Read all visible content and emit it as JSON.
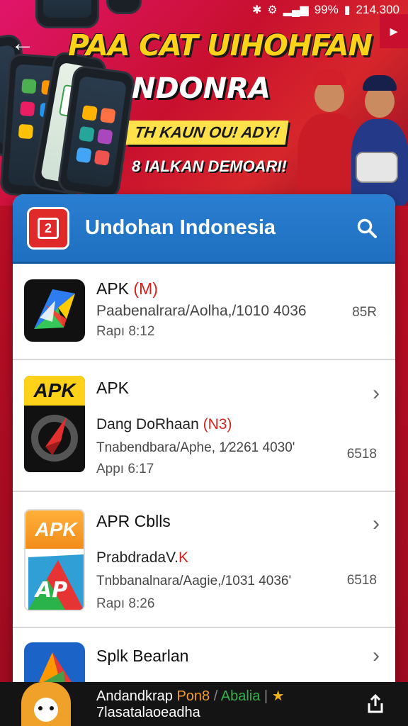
{
  "status_bar": {
    "battery": "99%",
    "time": "214.300"
  },
  "banner": {
    "headline": "PAA CAT UIHOHFAN",
    "subhead": "NDONRA",
    "tagline1": "TH KAUN OU! ADY!",
    "tagline2": "8 IALKAN DEMOARI!"
  },
  "header": {
    "logo_text": "2",
    "title": "Undohan Indonesia"
  },
  "items": [
    {
      "title": "APK",
      "badge": "(M)",
      "subtitle": "",
      "path": "Paabenalrara/Aolha,/1010 4036",
      "meta": "Rapı 8:12",
      "size": "85R",
      "icon_label": ""
    },
    {
      "title": "APK",
      "badge": "",
      "subtitle": "Dang DoRhaan",
      "subtitle_badge": "(N3)",
      "path": "Tnabendbara/Aphe, 1⁄2261 4030'",
      "meta": "Appı 6:17",
      "size": "6518",
      "icon_label": "APK"
    },
    {
      "title": "APR Cblls",
      "badge": "",
      "subtitle": "PrabdradaV.",
      "subtitle_badge": "K",
      "path": "Tnbbanalnara/Aagie,/1031 4036'",
      "meta": "Rapı 8:26",
      "size": "6518",
      "icon_label": "APK"
    },
    {
      "title": "Splk Bearlan",
      "badge": "",
      "subtitle": "",
      "path": "",
      "meta": "",
      "size": "",
      "icon_label": ""
    }
  ],
  "bottom_bar": {
    "line1_a": "Andandkrap",
    "line1_b": "Pon8",
    "line1_c": "Abalia",
    "line2": "7lasatalaoeadha"
  },
  "colors": {
    "accent_blue": "#1e6fbf",
    "brand_red": "#c8102e",
    "badge_red": "#d6221e"
  }
}
